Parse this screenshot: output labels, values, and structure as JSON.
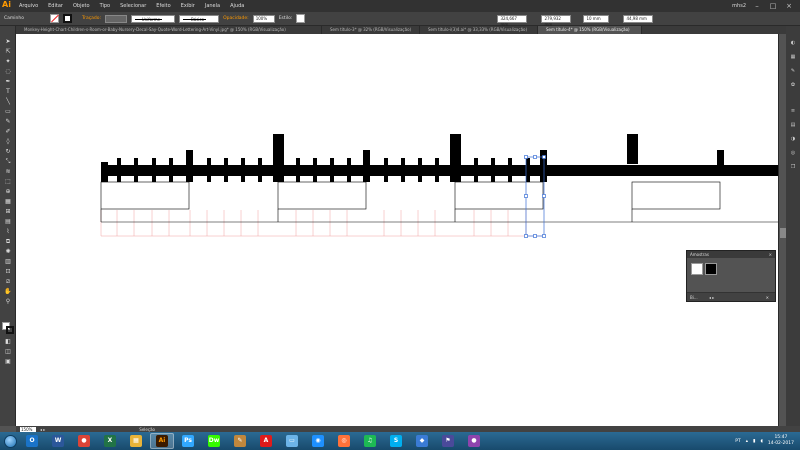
{
  "app": {
    "logo": "Ai"
  },
  "menu": [
    "Arquivo",
    "Editar",
    "Objeto",
    "Tipo",
    "Selecionar",
    "Efeito",
    "Exibir",
    "Janela",
    "Ajuda"
  ],
  "menubar_right": {
    "user": "mhs2",
    "minimize": "–",
    "maximize": "□",
    "close": "×"
  },
  "control": {
    "path_label": "Caminho",
    "stroke_label": "Traçado:",
    "uniform": "Uniforme",
    "basic": "Básico",
    "opacity_label": "Opacidade:",
    "opacity_value": "100%",
    "style_label": "Estilo:",
    "x_value": "324,667 mm",
    "y_value": "279,932 mm",
    "w_value": "10 mm",
    "h_value": "44,98 mm"
  },
  "tabs": [
    {
      "label": "Monkey-Height-Chart-Children-s-Room-or-Baby-Nursery-Decal-Say-Quote-Word-Lettering-Art-Vinyl.jpg* @ 150% (RGB/Visualização)",
      "active": false
    },
    {
      "label": "Sem título-3* @ 32% (RGB/Visualização)",
      "active": false
    },
    {
      "label": "Sem título-i(3)4.ai* @ 33,33% (RGB/Visualização)",
      "active": false
    },
    {
      "label": "Sem título-4* @ 150% (RGB/Visualização)",
      "active": true
    }
  ],
  "panel": {
    "title": "Amostras",
    "close": "×",
    "footer_left": "Bi..."
  },
  "status": {
    "zoom": "150%",
    "label": "Seleção"
  },
  "taskbar": {
    "apps": [
      {
        "label": "O",
        "name": "outlook",
        "color": "#1a73c8"
      },
      {
        "label": "W",
        "name": "word",
        "color": "#2b579a"
      },
      {
        "label": "●",
        "name": "chrome",
        "color": "#db4437"
      },
      {
        "label": "X",
        "name": "excel",
        "color": "#217346"
      },
      {
        "label": "▦",
        "name": "explorer",
        "color": "#e8b339"
      },
      {
        "label": "Ai",
        "name": "illustrator",
        "color": "#ff9a00"
      },
      {
        "label": "Ps",
        "name": "photoshop",
        "color": "#31a8ff"
      },
      {
        "label": "Dw",
        "name": "dreamweaver",
        "color": "#35fa00"
      },
      {
        "label": "✎",
        "name": "paint",
        "color": "#c0873d"
      },
      {
        "label": "A",
        "name": "acrobat",
        "color": "#e01b1b"
      },
      {
        "label": "▭",
        "name": "monitor",
        "color": "#6cb4e8"
      },
      {
        "label": "◉",
        "name": "edge",
        "color": "#1e90ff"
      },
      {
        "label": "◎",
        "name": "firefox",
        "color": "#ff7139"
      },
      {
        "label": "♫",
        "name": "spotify",
        "color": "#1db954"
      },
      {
        "label": "S",
        "name": "skype",
        "color": "#00aff0"
      },
      {
        "label": "◆",
        "name": "app-triangle",
        "color": "#3a7bd5"
      },
      {
        "label": "⚑",
        "name": "flag-app",
        "color": "#4a4a9a"
      },
      {
        "label": "●",
        "name": "other-app",
        "color": "#8e44ad"
      }
    ],
    "tray_lang": "PT",
    "time": "15:47",
    "date": "14-02-2017"
  }
}
